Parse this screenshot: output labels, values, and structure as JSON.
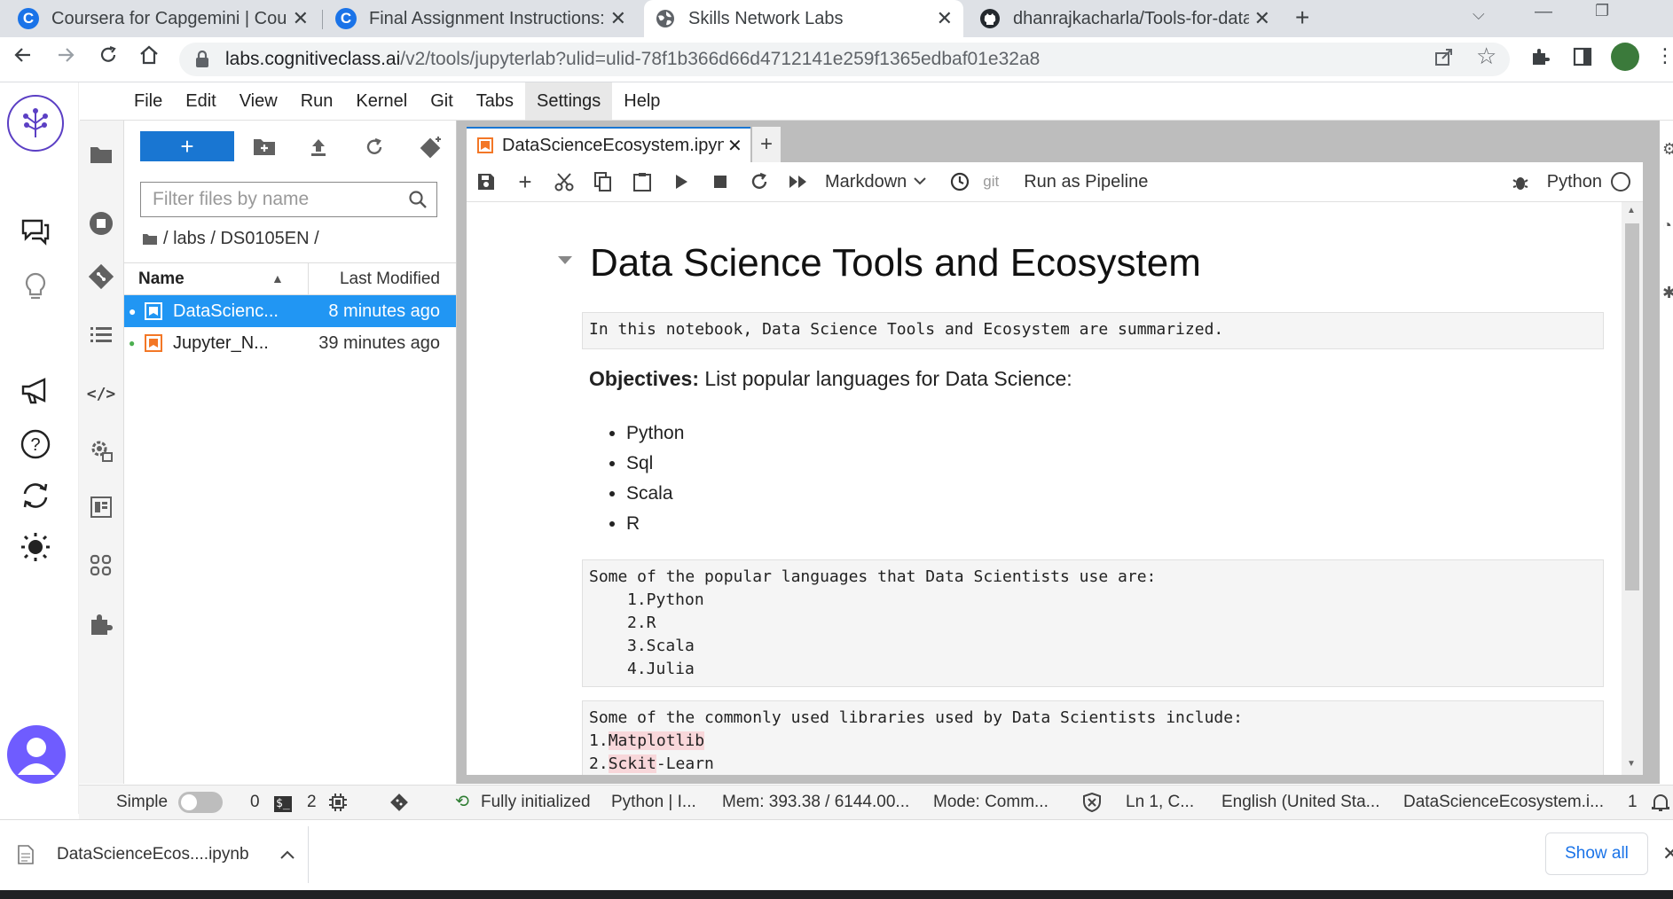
{
  "browser": {
    "tabs": [
      {
        "title": "Coursera for Capgemini | Courser",
        "favicon": "coursera-icon"
      },
      {
        "title": "Final Assignment Instructions: Cr",
        "favicon": "coursera-icon"
      },
      {
        "title": "Skills Network Labs",
        "favicon": "globe-icon"
      },
      {
        "title": "dhanrajkacharla/Tools-for-datasc",
        "favicon": "github-icon"
      }
    ],
    "url_host": "labs.cognitiveclass.ai",
    "url_rest": "/v2/tools/jupyterlab?ulid=ulid-78f1b366d66d4712141e259f1365edbaf01e32a8"
  },
  "menu": [
    "File",
    "Edit",
    "View",
    "Run",
    "Kernel",
    "Git",
    "Tabs",
    "Settings",
    "Help"
  ],
  "filebrowser": {
    "filter_placeholder": "Filter files by name",
    "breadcrumb": "/ labs / DS0105EN /",
    "col_name": "Name",
    "col_modified": "Last Modified",
    "files": [
      {
        "name": "DataScienc...",
        "modified": "8 minutes ago"
      },
      {
        "name": "Jupyter_N...",
        "modified": "39 minutes ago"
      }
    ]
  },
  "notebook": {
    "tab_title": "DataScienceEcosystem.ipynb",
    "cell_type": "Markdown",
    "git_label": "git",
    "pipeline_label": "Run as Pipeline",
    "kernel": "Python",
    "heading": "Data Science Tools and Ecosystem",
    "intro": "In this notebook, Data Science Tools and Ecosystem are summarized.",
    "objectives_label": "Objectives:",
    "objectives_text": "List popular languages for Data Science:",
    "bullets": [
      "Python",
      "Sql",
      "Scala",
      "R"
    ],
    "languages_intro": "Some of the popular languages that Data Scientists use are:",
    "languages": [
      "1.Python",
      "2.R",
      "3.Scala",
      "4.Julia"
    ],
    "libraries_intro": "Some of the commonly used libraries used by Data Scientists include:",
    "libraries": [
      {
        "num": "1.",
        "hl": "Matplotlib",
        "rest": ""
      },
      {
        "num": "2.",
        "hl": "Sckit",
        "rest": "-Learn"
      }
    ]
  },
  "status": {
    "mode_label": "Simple",
    "zero": "0",
    "terminal_badge": "$_",
    "two": "2",
    "initialized": "Fully initialized",
    "kernel": "Python | I...",
    "mem": "Mem: 393.38 / 6144.00...",
    "mode": "Mode: Comm...",
    "position": "Ln 1, C...",
    "language": "English (United Sta...",
    "filename": "DataScienceEcosystem.i...",
    "notifications": "1"
  },
  "downloads": {
    "file": "DataScienceEcos....ipynb",
    "show_all": "Show all"
  }
}
